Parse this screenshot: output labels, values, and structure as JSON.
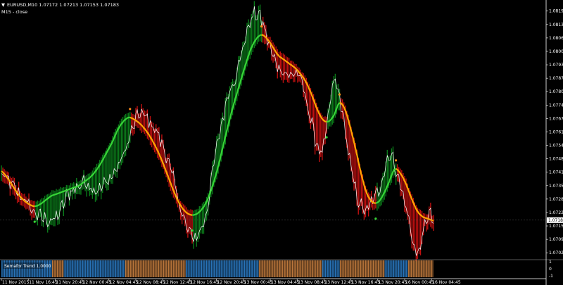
{
  "header": {
    "symbol_line": "EURUSD,M10  1.07172 1.07213 1.07153 1.07183",
    "indicator_line": "M15 - close",
    "dropdown_icon": "triangle-down-icon"
  },
  "colors": {
    "background": "#000000",
    "axis": "#ffffff",
    "price": "#ffffff",
    "ma_up": "#37d437",
    "ma_down": "#ffa500",
    "hist_up": "#0b7a1a",
    "hist_down": "#c01010",
    "dot_up": "#37d437",
    "dot_down": "#ff8c1a",
    "sub_blue": "#2f86d6",
    "sub_orange": "#d98a45",
    "price_tag_bg": "#ffffff"
  },
  "price_axis": {
    "labels": [
      "1.08195",
      "1.08130",
      "1.08065",
      "1.08000",
      "1.07935",
      "1.07870",
      "1.07805",
      "1.07740",
      "1.07675",
      "1.07610",
      "1.07545",
      "1.07480",
      "1.07415",
      "1.07350",
      "1.07285",
      "1.07220",
      "1.07155",
      "1.07090",
      "1.07025"
    ],
    "current_price": "1.07183"
  },
  "sub_window": {
    "label": "Semafor Trend 1.0000",
    "axis_labels": [
      "1",
      "0",
      "-1"
    ],
    "segments": [
      {
        "state": "blue",
        "bars": 52
      },
      {
        "state": "orange",
        "bars": 12
      },
      {
        "state": "blue",
        "bars": 63
      },
      {
        "state": "orange",
        "bars": 62
      },
      {
        "state": "blue",
        "bars": 75
      },
      {
        "state": "orange",
        "bars": 65
      },
      {
        "state": "blue",
        "bars": 18
      },
      {
        "state": "orange",
        "bars": 46
      },
      {
        "state": "blue",
        "bars": 24
      },
      {
        "state": "orange",
        "bars": 26
      }
    ]
  },
  "time_axis": {
    "labels": [
      "11 Nov 2015",
      "11 Nov 16:45",
      "11 Nov 20:45",
      "12 Nov 00:45",
      "12 Nov 04:45",
      "12 Nov 08:45",
      "12 Nov 12:45",
      "12 Nov 16:45",
      "12 Nov 20:45",
      "13 Nov 00:45",
      "13 Nov 04:45",
      "13 Nov 08:45",
      "13 Nov 12:45",
      "13 Nov 16:45",
      "13 Nov 20:45",
      "16 Nov 00:45",
      "16 Nov 04:45"
    ]
  },
  "chart_data": {
    "type": "line",
    "price_range": [
      1.06995,
      1.08235
    ],
    "series": [
      {
        "values": [
          1.074,
          1.0738,
          1.0735,
          1.0731,
          1.0729,
          1.0725,
          1.0722,
          1.072,
          1.0719,
          1.0718,
          1.072,
          1.0725,
          1.0731,
          1.0733,
          1.0735,
          1.0737,
          1.0735,
          1.0733,
          1.0734,
          1.0737,
          1.074,
          1.0744,
          1.075,
          1.0757,
          1.0765,
          1.077,
          1.0768,
          1.0765,
          1.0761,
          1.0755,
          1.0748,
          1.0738,
          1.0728,
          1.0718,
          1.0712,
          1.071,
          1.0714,
          1.0722,
          1.074,
          1.0755,
          1.0768,
          1.078,
          1.0786,
          1.0795,
          1.0806,
          1.0815,
          1.0818,
          1.0815,
          1.0806,
          1.0798,
          1.0793,
          1.079,
          1.0788,
          1.079,
          1.0786,
          1.0777,
          1.0765,
          1.0755,
          1.0752,
          1.0768,
          1.0785,
          1.0778,
          1.0763,
          1.0745,
          1.0732,
          1.0725,
          1.0723,
          1.0728,
          1.0732,
          1.0741,
          1.075,
          1.0745,
          1.0735,
          1.0725,
          1.0712,
          1.0702,
          1.071,
          1.0721,
          1.0718
        ]
      },
      {
        "values": [
          1.0742,
          1.0739,
          1.0735,
          1.0731,
          1.0728,
          1.0726,
          1.0725,
          1.0726,
          1.0728,
          1.073,
          1.0731,
          1.0732,
          1.0733,
          1.0734,
          1.0735,
          1.0737,
          1.0739,
          1.0742,
          1.0746,
          1.0751,
          1.0756,
          1.0762,
          1.0766,
          1.0768,
          1.0767,
          1.0765,
          1.0762,
          1.0758,
          1.0753,
          1.0747,
          1.074,
          1.0733,
          1.0727,
          1.0723,
          1.0721,
          1.0721,
          1.0723,
          1.0727,
          1.0734,
          1.0743,
          1.0754,
          1.0765,
          1.0775,
          1.0784,
          1.0793,
          1.0801,
          1.0806,
          1.0808,
          1.0806,
          1.0802,
          1.0798,
          1.0796,
          1.0794,
          1.0792,
          1.0789,
          1.0785,
          1.0779,
          1.0772,
          1.0767,
          1.0766,
          1.0769,
          1.0775,
          1.0772,
          1.0763,
          1.0752,
          1.074,
          1.0731,
          1.0727,
          1.0727,
          1.0731,
          1.0737,
          1.0743,
          1.0741,
          1.0736,
          1.0729,
          1.0723,
          1.072,
          1.0719,
          1.0718
        ]
      }
    ]
  }
}
